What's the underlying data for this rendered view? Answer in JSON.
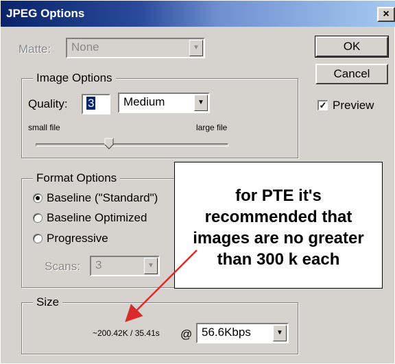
{
  "window": {
    "title": "JPEG Options",
    "close_label": "×"
  },
  "matte": {
    "label": "Matte:",
    "value": "None"
  },
  "image_options": {
    "legend": "Image Options",
    "quality_label": "Quality:",
    "quality_value": "3",
    "quality_preset": "Medium",
    "small_file": "small file",
    "large_file": "large file",
    "slider_level": 3,
    "slider_max": 12
  },
  "buttons": {
    "ok": "OK",
    "cancel": "Cancel"
  },
  "preview": {
    "label": "Preview",
    "checked": true,
    "check_glyph": "✓"
  },
  "format_options": {
    "legend": "Format Options",
    "options": [
      "Baseline (\"Standard\")",
      "Baseline Optimized",
      "Progressive"
    ],
    "selected_index": 0,
    "scans_label": "Scans:",
    "scans_value": "3"
  },
  "size": {
    "legend": "Size",
    "readout": "~200.42K / 35.41s",
    "at": "@",
    "connection": "56.6Kbps"
  },
  "callout": {
    "lines": [
      "for PTE it's",
      "recommended that",
      "images are no greater",
      "than 300 k each"
    ],
    "arrow_color": "#d92b2b"
  },
  "colors": {
    "titlebar_start": "#0a246a",
    "titlebar_end": "#a6caf0",
    "dialog_bg": "#d6d3ce"
  },
  "icons": {
    "dropdown": "▼"
  }
}
